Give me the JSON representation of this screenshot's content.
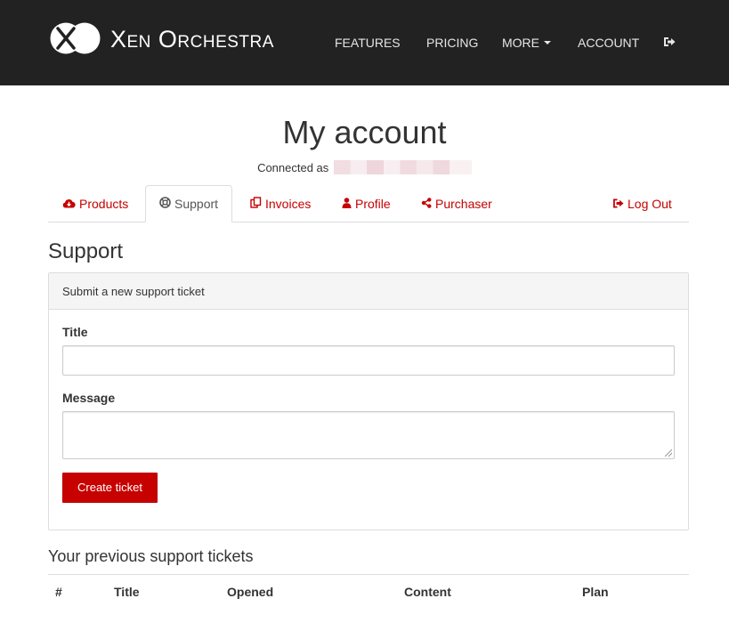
{
  "brand": {
    "name": "Xen Orchestra"
  },
  "nav": {
    "features": "FEATURES",
    "pricing": "PRICING",
    "more": "MORE",
    "account": "ACCOUNT"
  },
  "page": {
    "title": "My account",
    "connected_as": "Connected as"
  },
  "tabs": {
    "products": "Products",
    "support": "Support",
    "invoices": "Invoices",
    "profile": "Profile",
    "purchaser": "Purchaser",
    "logout": "Log Out"
  },
  "support": {
    "title": "Support",
    "panel_heading": "Submit a new support ticket",
    "title_label": "Title",
    "title_value": "",
    "message_label": "Message",
    "message_value": "",
    "create_button": "Create ticket"
  },
  "tickets": {
    "title": "Your previous support tickets",
    "columns": [
      "#",
      "Title",
      "Opened",
      "Content",
      "Plan"
    ]
  },
  "colors": {
    "accent": "#c70000",
    "navbar": "#222222"
  }
}
